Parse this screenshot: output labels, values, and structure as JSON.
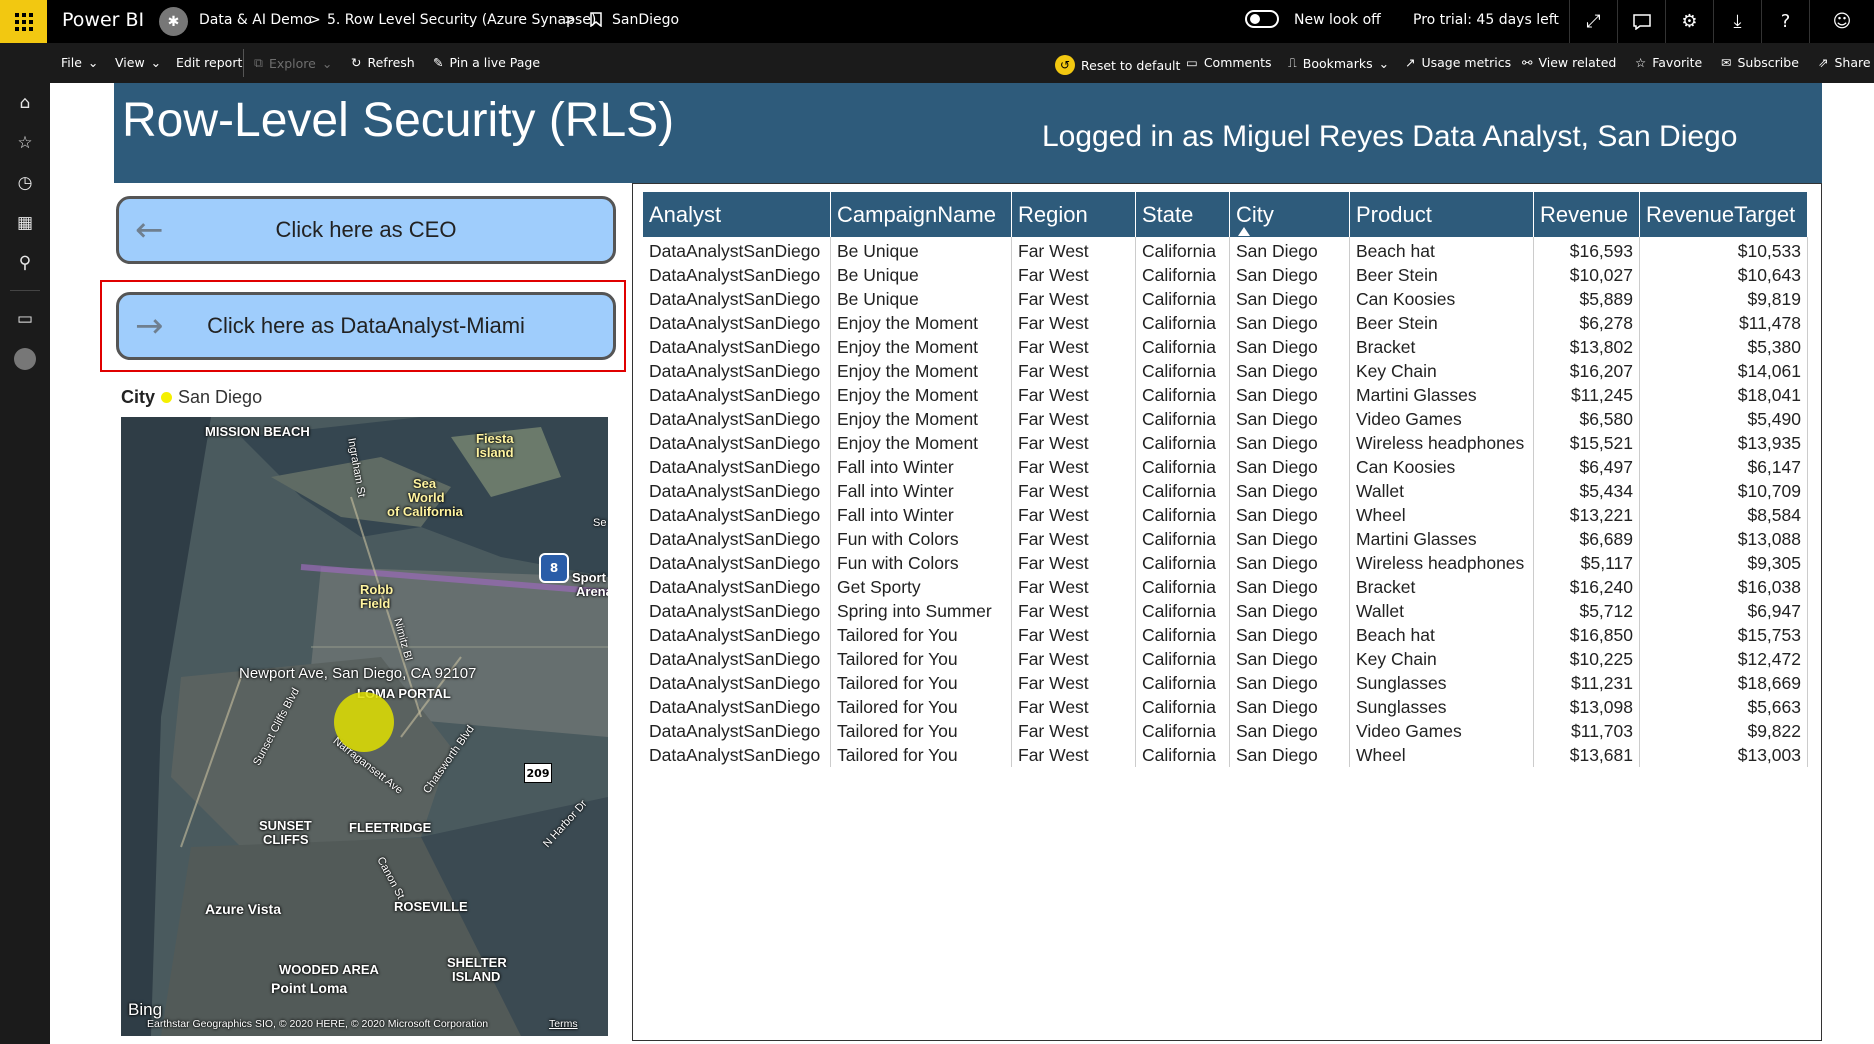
{
  "topbar": {
    "brand": "Power BI",
    "workspace": "Data & AI Demo",
    "sep1": ">",
    "report": "5. Row Level Security (Azure Synapse)",
    "sep2": ">",
    "page": "SanDiego",
    "new_look": "New look off",
    "trial": "Pro trial: 45 days left",
    "icons": [
      "expand-icon",
      "feedback-icon",
      "gear-icon",
      "download-icon",
      "help-icon",
      "smiley-icon"
    ]
  },
  "actionbar": {
    "file": "File",
    "view": "View",
    "edit_report": "Edit report",
    "explore": "Explore",
    "refresh": "Refresh",
    "pin_live": "Pin a live Page",
    "reset": "Reset to default",
    "comments": "Comments",
    "bookmarks": "Bookmarks",
    "usage": "Usage metrics",
    "view_related": "View related",
    "favorite": "Favorite",
    "subscribe": "Subscribe",
    "share": "Share"
  },
  "leftnav": [
    "hamburger-icon",
    "home-icon",
    "star-icon",
    "clock-icon",
    "apps-icon",
    "shared-icon",
    "workspaces-icon",
    "workspace-avatar-icon"
  ],
  "report": {
    "title": "Row-Level Security (RLS)",
    "logged_in": "Logged in as Miguel Reyes Data Analyst, San Diego",
    "btn_ceo": "Click here as CEO",
    "btn_miami": "Click here as DataAnalyst-Miami",
    "legend_field": "City",
    "legend_value": "San Diego",
    "legend_color": "#f5f000"
  },
  "map": {
    "labels": {
      "mission_beach": "MISSION BEACH",
      "fiesta1": "Fiesta",
      "fiesta2": "Island",
      "ingraham": "Ingraham St",
      "sea1": "Sea",
      "sea2": "World",
      "sea3": "of California",
      "se": "Se",
      "i8": "8",
      "sport1": "Sport",
      "sport2": "Arena",
      "robb1": "Robb",
      "robb2": "Field",
      "nimitz": "Nimitz Bl",
      "address": "Newport Ave, San Diego, CA 92107",
      "loma_portal": "LOMA PORTAL",
      "sunset_cliffs_blvd": "Sunset Cliffs Blvd",
      "narragansett": "Narragansett Ave",
      "chatsworth": "Chatsworth Blvd",
      "r209": "209",
      "sunset1": "SUNSET",
      "sunset2": "CLIFFS",
      "fleetridge": "FLEETRIDGE",
      "harbor": "N Harbor Dr",
      "canon": "Canon St",
      "azure_vista": "Azure Vista",
      "roseville": "ROSEVILLE",
      "wooded": "WOODED AREA",
      "shelter1": "SHELTER",
      "shelter2": "ISLAND",
      "point_loma": "Point Loma",
      "bing": "Bing",
      "copyright": "Earthstar Geographics SIO, © 2020 HERE, © 2020 Microsoft Corporation",
      "terms": "Terms"
    }
  },
  "table": {
    "columns": [
      "Analyst",
      "CampaignName",
      "Region",
      "State",
      "City",
      "Product",
      "Revenue",
      "RevenueTarget"
    ],
    "sorted_column": "City",
    "rows": [
      [
        "DataAnalystSanDiego",
        "Be Unique",
        "Far West",
        "California",
        "San Diego",
        "Beach hat",
        "$16,593",
        "$10,533"
      ],
      [
        "DataAnalystSanDiego",
        "Be Unique",
        "Far West",
        "California",
        "San Diego",
        "Beer Stein",
        "$10,027",
        "$10,643"
      ],
      [
        "DataAnalystSanDiego",
        "Be Unique",
        "Far West",
        "California",
        "San Diego",
        "Can Koosies",
        "$5,889",
        "$9,819"
      ],
      [
        "DataAnalystSanDiego",
        "Enjoy the Moment",
        "Far West",
        "California",
        "San Diego",
        "Beer Stein",
        "$6,278",
        "$11,478"
      ],
      [
        "DataAnalystSanDiego",
        "Enjoy the Moment",
        "Far West",
        "California",
        "San Diego",
        "Bracket",
        "$13,802",
        "$5,380"
      ],
      [
        "DataAnalystSanDiego",
        "Enjoy the Moment",
        "Far West",
        "California",
        "San Diego",
        "Key Chain",
        "$16,207",
        "$14,061"
      ],
      [
        "DataAnalystSanDiego",
        "Enjoy the Moment",
        "Far West",
        "California",
        "San Diego",
        "Martini Glasses",
        "$11,245",
        "$18,041"
      ],
      [
        "DataAnalystSanDiego",
        "Enjoy the Moment",
        "Far West",
        "California",
        "San Diego",
        "Video Games",
        "$6,580",
        "$5,490"
      ],
      [
        "DataAnalystSanDiego",
        "Enjoy the Moment",
        "Far West",
        "California",
        "San Diego",
        "Wireless headphones",
        "$15,521",
        "$13,935"
      ],
      [
        "DataAnalystSanDiego",
        "Fall into Winter",
        "Far West",
        "California",
        "San Diego",
        "Can Koosies",
        "$6,497",
        "$6,147"
      ],
      [
        "DataAnalystSanDiego",
        "Fall into Winter",
        "Far West",
        "California",
        "San Diego",
        "Wallet",
        "$5,434",
        "$10,709"
      ],
      [
        "DataAnalystSanDiego",
        "Fall into Winter",
        "Far West",
        "California",
        "San Diego",
        "Wheel",
        "$13,221",
        "$8,584"
      ],
      [
        "DataAnalystSanDiego",
        "Fun with Colors",
        "Far West",
        "California",
        "San Diego",
        "Martini Glasses",
        "$6,689",
        "$13,088"
      ],
      [
        "DataAnalystSanDiego",
        "Fun with Colors",
        "Far West",
        "California",
        "San Diego",
        "Wireless headphones",
        "$5,117",
        "$9,305"
      ],
      [
        "DataAnalystSanDiego",
        "Get Sporty",
        "Far West",
        "California",
        "San Diego",
        "Bracket",
        "$16,240",
        "$16,038"
      ],
      [
        "DataAnalystSanDiego",
        "Spring into Summer",
        "Far West",
        "California",
        "San Diego",
        "Wallet",
        "$5,712",
        "$6,947"
      ],
      [
        "DataAnalystSanDiego",
        "Tailored for You",
        "Far West",
        "California",
        "San Diego",
        "Beach hat",
        "$16,850",
        "$15,753"
      ],
      [
        "DataAnalystSanDiego",
        "Tailored for You",
        "Far West",
        "California",
        "San Diego",
        "Key Chain",
        "$10,225",
        "$12,472"
      ],
      [
        "DataAnalystSanDiego",
        "Tailored for You",
        "Far West",
        "California",
        "San Diego",
        "Sunglasses",
        "$11,231",
        "$18,669"
      ],
      [
        "DataAnalystSanDiego",
        "Tailored for You",
        "Far West",
        "California",
        "San Diego",
        "Sunglasses",
        "$13,098",
        "$5,663"
      ],
      [
        "DataAnalystSanDiego",
        "Tailored for You",
        "Far West",
        "California",
        "San Diego",
        "Video Games",
        "$11,703",
        "$9,822"
      ],
      [
        "DataAnalystSanDiego",
        "Tailored for You",
        "Far West",
        "California",
        "San Diego",
        "Wheel",
        "$13,681",
        "$13,003"
      ]
    ]
  },
  "colors": {
    "title_bar": "#2e5b7b",
    "button_fill": "#9fcdfc",
    "accent": "#f2c811",
    "selection": "#e00000"
  }
}
